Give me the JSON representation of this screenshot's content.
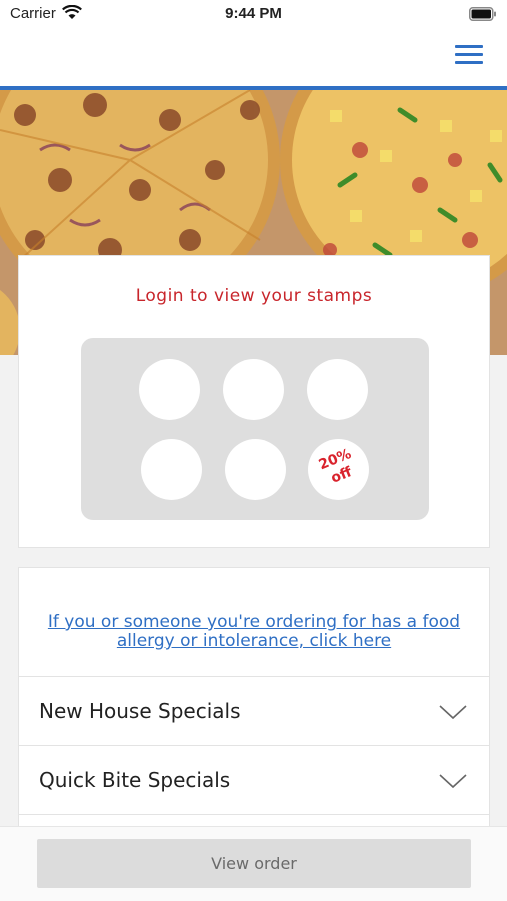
{
  "status_bar": {
    "carrier": "Carrier",
    "time": "9:44 PM"
  },
  "nav": {
    "menu_icon": "hamburger-menu-icon",
    "accent_color": "#2f6fc4"
  },
  "hero": {
    "image": "pizza-hero-photo"
  },
  "stamps": {
    "title": "Login to view your stamps",
    "title_color": "#c8252b",
    "total": 6,
    "reward_text_line1": "20%",
    "reward_text_line2": "off",
    "reward_color": "#d9232d"
  },
  "allergy": {
    "link_text": "If you or someone you're ordering for has a food allergy or intolerance, click here",
    "link_color": "#2f6fc4"
  },
  "categories": [
    {
      "label": "New House Specials"
    },
    {
      "label": "Quick Bite Specials"
    }
  ],
  "bottom": {
    "view_order_label": "View order"
  }
}
